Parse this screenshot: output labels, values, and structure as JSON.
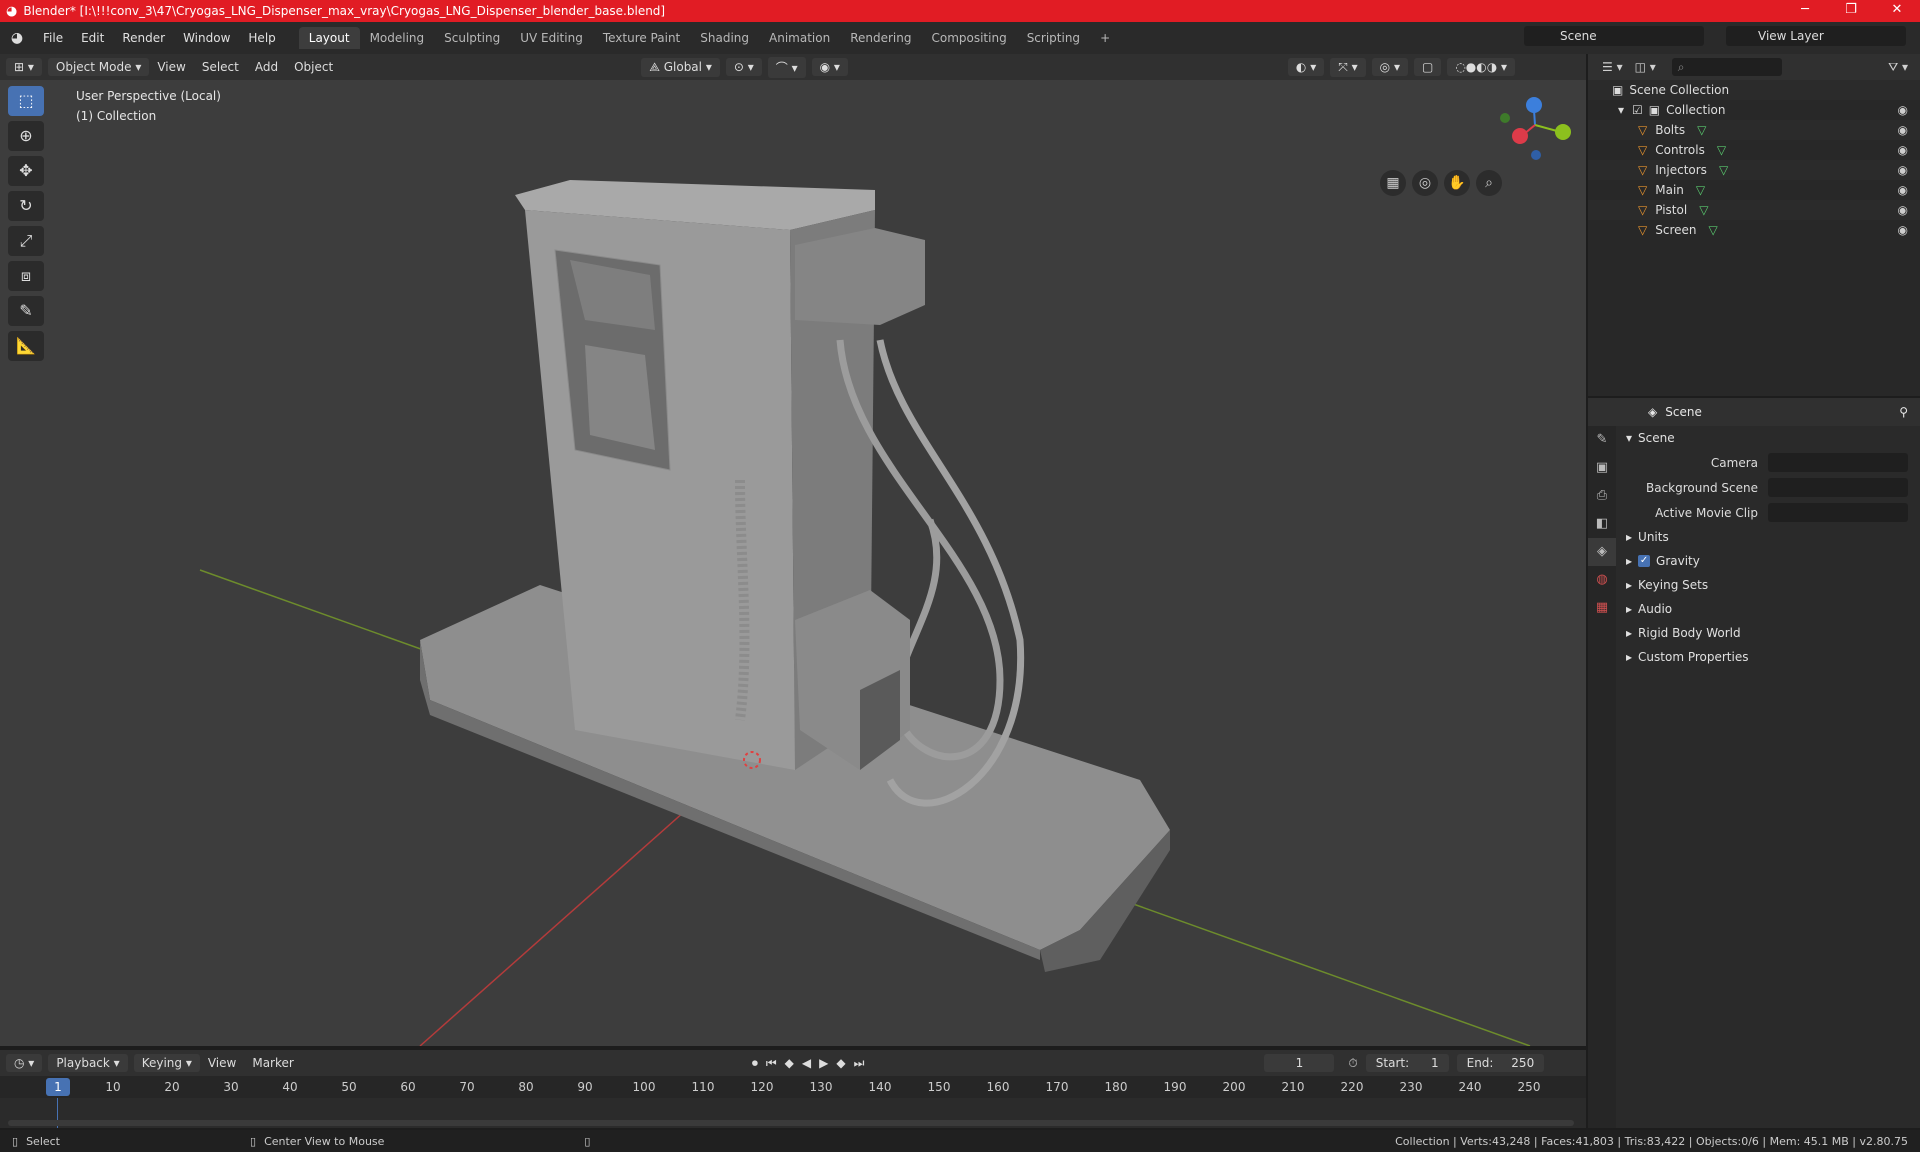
{
  "window": {
    "title": "Blender* [I:\\!!!conv_3\\47\\Cryogas_LNG_Dispenser_max_vray\\Cryogas_LNG_Dispenser_blender_base.blend]",
    "minimize": "─",
    "maximize": "❐",
    "close": "✕"
  },
  "menu": {
    "items": [
      "File",
      "Edit",
      "Render",
      "Window",
      "Help"
    ],
    "workspaces": [
      "Layout",
      "Modeling",
      "Sculpting",
      "UV Editing",
      "Texture Paint",
      "Shading",
      "Animation",
      "Rendering",
      "Compositing",
      "Scripting"
    ],
    "active_workspace": "Layout",
    "scene": "Scene",
    "view_layer": "View Layer"
  },
  "viewport_header": {
    "mode": "Object Mode",
    "menus": [
      "View",
      "Select",
      "Add",
      "Object"
    ],
    "transform_orientation": "Global"
  },
  "viewport": {
    "perspective_label": "User Perspective (Local)",
    "collection_label": "(1) Collection",
    "gizmo": {
      "x": "X",
      "y": "Y",
      "z": "Z"
    }
  },
  "outliner": {
    "root": "Scene Collection",
    "collection": "Collection",
    "objects": [
      "Bolts",
      "Controls",
      "Injectors",
      "Main",
      "Pistol",
      "Screen"
    ]
  },
  "properties": {
    "context": "Scene",
    "panel_title": "Scene",
    "fields": [
      {
        "label": "Camera",
        "value": ""
      },
      {
        "label": "Background Scene",
        "value": ""
      },
      {
        "label": "Active Movie Clip",
        "value": ""
      }
    ],
    "sections": [
      "Units",
      "Gravity",
      "Keying Sets",
      "Audio",
      "Rigid Body World",
      "Custom Properties"
    ]
  },
  "timeline": {
    "menus": [
      "Playback",
      "Keying",
      "View",
      "Marker"
    ],
    "current_frame": "1",
    "start_label": "Start:",
    "start": "1",
    "end_label": "End:",
    "end": "250",
    "ticks": [
      "1",
      "10",
      "20",
      "30",
      "40",
      "50",
      "60",
      "70",
      "80",
      "90",
      "100",
      "110",
      "120",
      "130",
      "140",
      "150",
      "160",
      "170",
      "180",
      "190",
      "200",
      "210",
      "220",
      "230",
      "240",
      "250"
    ]
  },
  "status": {
    "left_action": "Select",
    "middle_action": "Center View to Mouse",
    "stats": "Collection | Verts:43,248 | Faces:41,803 | Tris:83,422 | Objects:0/6 | Mem: 45.1 MB | v2.80.75"
  },
  "colors": {
    "accent": "#4772b3",
    "title_bar": "#e11c24",
    "object_orange": "#e5922e",
    "mesh_green": "#59c86e"
  }
}
